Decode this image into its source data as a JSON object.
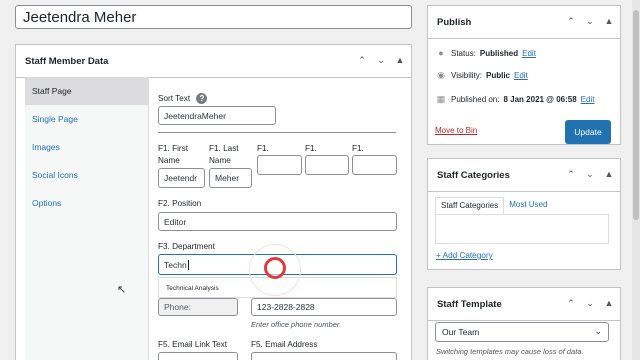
{
  "post_title": "Jeetendra Meher",
  "staff_box": {
    "title": "Staff Member Data",
    "tabs": [
      "Staff Page",
      "Single Page",
      "Images",
      "Social Icons",
      "Options"
    ],
    "sort_text": {
      "label": "Sort Text",
      "value": "JeetendraMeher"
    },
    "name_fields": [
      {
        "label_line1": "F1. First",
        "label_line2": "Name",
        "value": "Jeetendr"
      },
      {
        "label_line1": "F1. Last",
        "label_line2": "Name",
        "value": "Meher"
      },
      {
        "label_line1": "F1.",
        "label_line2": "",
        "value": ""
      },
      {
        "label_line1": "F1.",
        "label_line2": "",
        "value": ""
      },
      {
        "label_line1": "F1.",
        "label_line2": "",
        "value": ""
      }
    ],
    "position": {
      "label": "F2. Position",
      "value": "Editor"
    },
    "department": {
      "label": "F3. Department",
      "value": "Techn"
    },
    "suggestion": "Technical Analysis",
    "phone_label_value": "Phone:",
    "phone_value": "123-2828-2828",
    "phone_hint": "Enter office phone number.",
    "email_link_label": "F5. Email Link Text",
    "email_address_label": "F5. Email Address"
  },
  "publish": {
    "title": "Publish",
    "status_label": "Status:",
    "status_value": "Published",
    "visibility_label": "Visibility:",
    "visibility_value": "Public",
    "published_on_label": "Published on:",
    "published_on_value": "8 Jan 2021 @ 06:58",
    "edit_label": "Edit",
    "trash_label": "Move to Bin",
    "update_label": "Update"
  },
  "categories": {
    "title": "Staff Categories",
    "tab_all": "Staff Categories",
    "tab_most_used": "Most Used",
    "add_label": "+ Add Category"
  },
  "template": {
    "title": "Staff Template",
    "selected": "Our Team",
    "note": "Switching templates may cause loss of data."
  },
  "colors": {
    "primary": "#2271b1",
    "danger": "#b32d2e",
    "click_ring": "#e03a3a"
  },
  "icons": {
    "up": "chevron-up-icon",
    "down": "chevron-down-icon",
    "toggle": "triangle-up-icon"
  }
}
